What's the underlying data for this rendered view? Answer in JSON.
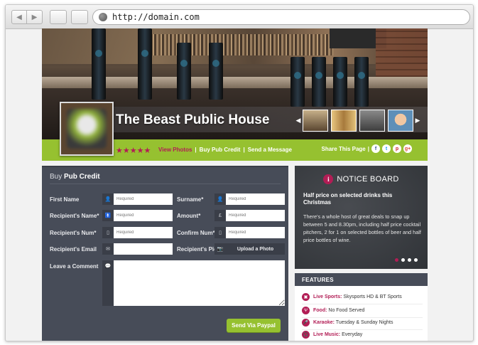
{
  "browser": {
    "url": "http://domain.com"
  },
  "venue": {
    "name": "The Beast Public House",
    "rating_stars": "★★★★★",
    "links": [
      "View Photos",
      "Buy Pub Credit",
      "Send a Message"
    ],
    "share_label": "Share This Page",
    "social": [
      "f",
      "t",
      "p",
      "g+"
    ]
  },
  "form": {
    "title_prefix": "Buy",
    "title_bold": "Pub Credit",
    "fields": {
      "first_name": {
        "label": "First Name",
        "placeholder": "Required"
      },
      "surname": {
        "label": "Surname*",
        "placeholder": "Required"
      },
      "recipient_name": {
        "label": "Recipient's Name*",
        "placeholder": "Required"
      },
      "amount": {
        "label": "Amount*",
        "placeholder": "Required"
      },
      "recipient_num": {
        "label": "Recipient's Num*",
        "placeholder": "Required"
      },
      "confirm_num": {
        "label": "Confirm Num*",
        "placeholder": "Required"
      },
      "recipient_email": {
        "label": "Recipient's Email",
        "placeholder": ""
      },
      "recipient_pic": {
        "label": "Recipient's Pic",
        "button": "Upload a Photo"
      },
      "comment": {
        "label": "Leave a Comment"
      }
    },
    "submit": "Send Via Paypal"
  },
  "notice_board": {
    "title": "NOTICE BOARD",
    "headline": "Half price on selected drinks this Christmas",
    "body": "There's a whole host of great deals to snap up between 5 and 8.30pm, including half price cocktail pitchers, 2 for 1 on selected bottles of beer and half price bottles of wine.",
    "slide_count": 4,
    "active_slide": 1
  },
  "features": {
    "title": "FEATURES",
    "items": [
      {
        "name": "Live Sports:",
        "value": "Skysports HD & BT Sports"
      },
      {
        "name": "Food:",
        "value": "No Food Served"
      },
      {
        "name": "Karaoke:",
        "value": "Tuesday & Sunday Nights"
      },
      {
        "name": "Live Music:",
        "value": "Everyday"
      }
    ]
  },
  "colors": {
    "accent_green": "#96c130",
    "accent_pink": "#b21d55",
    "panel": "#474c58"
  }
}
